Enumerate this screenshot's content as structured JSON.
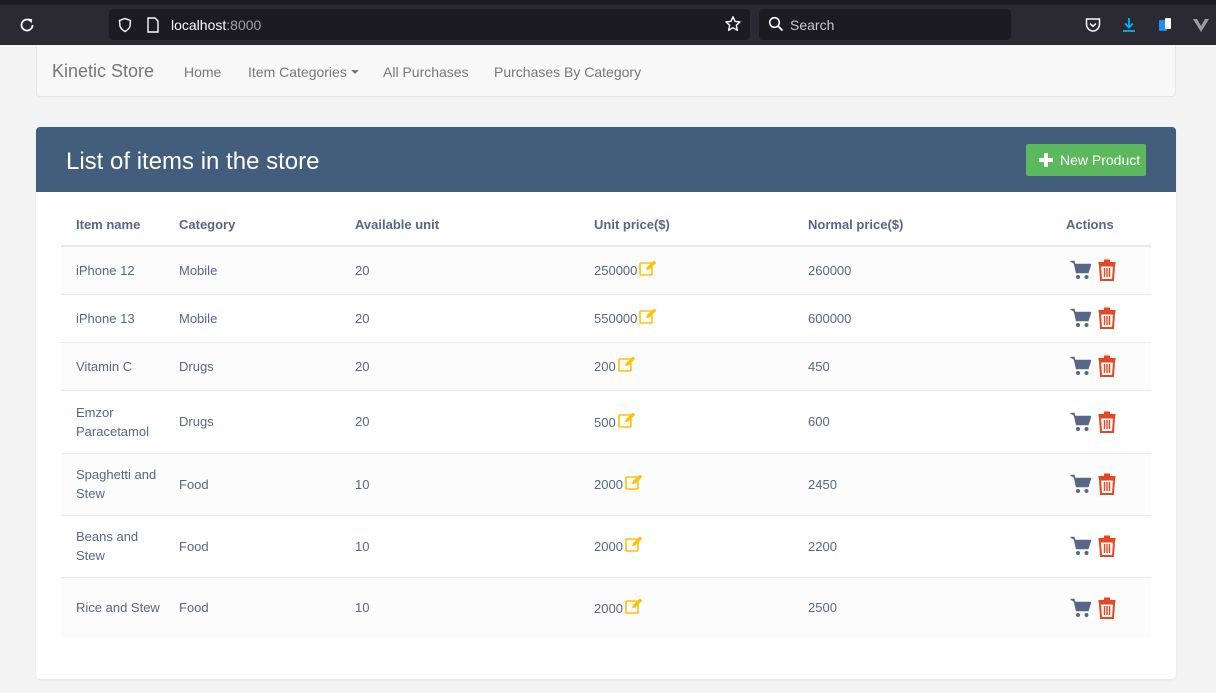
{
  "browser": {
    "url_host": "localhost",
    "url_port": ":8000",
    "search_placeholder": "Search"
  },
  "navbar": {
    "brand": "Kinetic Store",
    "links": [
      "Home",
      "Item Categories",
      "All Purchases",
      "Purchases By Category"
    ]
  },
  "panel": {
    "title": "List of items in the store",
    "new_button": "New Product"
  },
  "table": {
    "headers": [
      "Item name",
      "Category",
      "Available unit",
      "Unit price($)",
      "Normal price($)",
      "Actions"
    ],
    "rows": [
      {
        "name": "iPhone 12",
        "category": "Mobile",
        "units": "20",
        "unit_price": "250000",
        "normal_price": "260000"
      },
      {
        "name": "iPhone 13",
        "category": "Mobile",
        "units": "20",
        "unit_price": "550000",
        "normal_price": "600000"
      },
      {
        "name": "Vitamin C",
        "category": "Drugs",
        "units": "20",
        "unit_price": "200",
        "normal_price": "450"
      },
      {
        "name": "Emzor Paracetamol",
        "category": "Drugs",
        "units": "20",
        "unit_price": "500",
        "normal_price": "600"
      },
      {
        "name": "Spaghetti and Stew",
        "category": "Food",
        "units": "10",
        "unit_price": "2000",
        "normal_price": "2450"
      },
      {
        "name": "Beans and Stew",
        "category": "Food",
        "units": "10",
        "unit_price": "2000",
        "normal_price": "2200"
      },
      {
        "name": "Rice and Stew",
        "category": "Food",
        "units": "10",
        "unit_price": "2000",
        "normal_price": "2500"
      }
    ]
  },
  "colors": {
    "panel_header": "#435d7d",
    "new_button": "#5cb85c",
    "text": "#566787",
    "edit_icon": "#ffc107",
    "delete_icon": "#e34724",
    "cart_icon": "#566787"
  }
}
